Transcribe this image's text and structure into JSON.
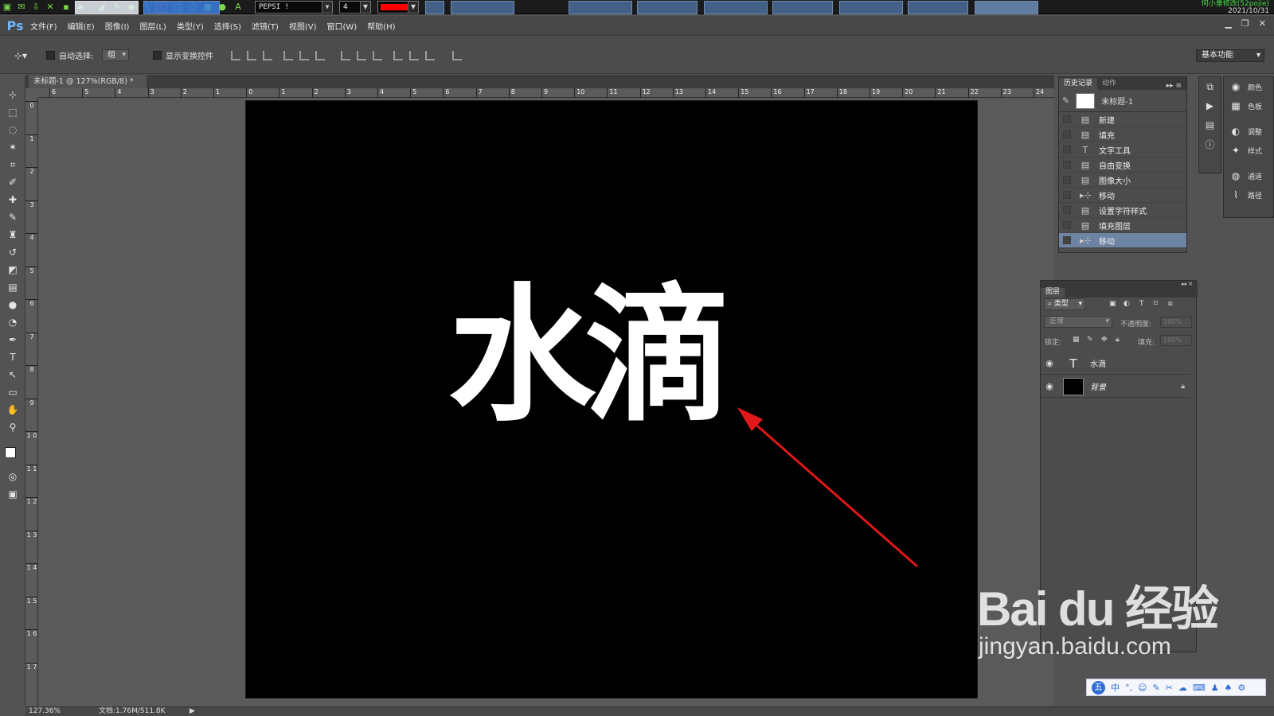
{
  "capture_toolbar": {
    "font_name": "PEPSI !",
    "pen_size": "4",
    "pen_color": "#ff0000",
    "tray_user": "何小墨修改(52pojie)",
    "tray_date": "2021/10/31"
  },
  "app": {
    "logo": "Ps"
  },
  "menus": [
    "文件(F)",
    "编辑(E)",
    "图像(I)",
    "图层(L)",
    "类型(Y)",
    "选择(S)",
    "滤镜(T)",
    "视图(V)",
    "窗口(W)",
    "帮助(H)"
  ],
  "options": {
    "auto_select_label": "自动选择:",
    "auto_select_value": "组",
    "show_transform_label": "显示变换控件",
    "workspace": "基本功能"
  },
  "document": {
    "tab_title": "未标题-1 @ 127%(RGB/8) *",
    "canvas_text": "水滴",
    "canvas_bg": "#000000",
    "text_color": "#ffffff",
    "arrow_color": "#e01818"
  },
  "ruler": {
    "h_ticks": [
      "6",
      "5",
      "4",
      "3",
      "2",
      "1",
      "0",
      "1",
      "2",
      "3",
      "4",
      "5",
      "6",
      "7",
      "8",
      "9",
      "10",
      "11",
      "12",
      "13",
      "14",
      "15",
      "16",
      "17",
      "18",
      "19",
      "20",
      "21",
      "22",
      "23",
      "24"
    ],
    "v_ticks": [
      "0",
      "1",
      "2",
      "3",
      "4",
      "5",
      "6",
      "7",
      "8",
      "9",
      "1 0",
      "1 1",
      "1 2",
      "1 3",
      "1 4",
      "1 5",
      "1 6",
      "1 7"
    ]
  },
  "status": {
    "zoom": "127.36%",
    "doc_size": "文档:1.76M/511.8K"
  },
  "history": {
    "tab_history": "历史记录",
    "tab_actions": "动作",
    "snapshot": "未标题-1",
    "items": [
      {
        "label": "新建",
        "icon": "doc-icon"
      },
      {
        "label": "填充",
        "icon": "doc-icon"
      },
      {
        "label": "文字工具",
        "icon": "type-icon"
      },
      {
        "label": "自由变换",
        "icon": "doc-icon"
      },
      {
        "label": "图像大小",
        "icon": "doc-icon"
      },
      {
        "label": "移动",
        "icon": "move-icon"
      },
      {
        "label": "设置字符样式",
        "icon": "doc-icon"
      },
      {
        "label": "填充图层",
        "icon": "doc-icon"
      },
      {
        "label": "移动",
        "icon": "move-icon",
        "selected": true
      }
    ]
  },
  "side_panels": [
    {
      "label": "颜色",
      "icon": "color-icon"
    },
    {
      "label": "色板",
      "icon": "swatches-icon"
    },
    {
      "label": "调整",
      "icon": "adjust-icon"
    },
    {
      "label": "样式",
      "icon": "styles-icon"
    },
    {
      "label": "通道",
      "icon": "channels-icon"
    },
    {
      "label": "路径",
      "icon": "paths-icon"
    }
  ],
  "layers": {
    "title": "图层",
    "filter": "类型",
    "blend_mode": "正常",
    "opacity_label": "不透明度:",
    "opacity_value": "100%",
    "lock_label": "锁定:",
    "fill_label": "填充:",
    "fill_value": "100%",
    "items": [
      {
        "name": "水滴",
        "kind": "text"
      },
      {
        "name": "背景",
        "kind": "background",
        "locked": true
      }
    ]
  },
  "ime": {
    "lang": "中"
  },
  "watermark": {
    "brand": "Bai du 经验",
    "url": "jingyan.baidu.com"
  }
}
